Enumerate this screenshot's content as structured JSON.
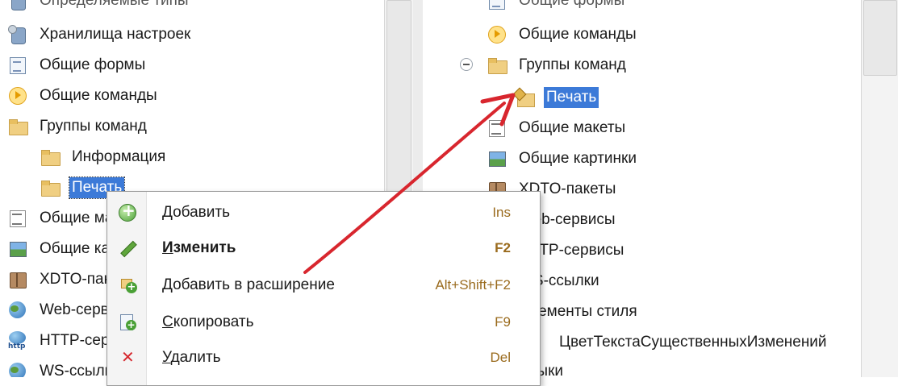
{
  "left_tree": {
    "top_partial": "Определяемые типы",
    "items": [
      "Хранилища настроек",
      "Общие формы",
      "Общие команды",
      "Группы команд",
      "Информация",
      "Печать",
      "Общие макеты",
      "Общие картинки",
      "XDTO-пакеты",
      "Web-сервисы",
      "HTTP-сервисы",
      "WS-ссылки"
    ]
  },
  "right_tree": {
    "top_partial": "Общие формы",
    "items": [
      "Общие команды",
      "Группы команд",
      "Печать",
      "Общие макеты",
      "Общие картинки",
      "XDTO-пакеты",
      "Web-сервисы",
      "HTTP-сервисы",
      "WS-ссылки",
      "Элементы стиля",
      "ЦветТекстаСущественныхИзменений",
      "Языки"
    ]
  },
  "context_menu": {
    "items": [
      {
        "label": "Добавить",
        "shortcut": "Ins",
        "icon": "add-icon"
      },
      {
        "label": "Изменить",
        "shortcut": "F2",
        "icon": "edit-icon",
        "bold": true
      },
      {
        "label": "Добавить в расширение",
        "shortcut": "Alt+Shift+F2",
        "icon": "add-to-extension-icon"
      },
      {
        "label": "Скопировать",
        "shortcut": "F9",
        "icon": "copy-icon"
      },
      {
        "label": "Удалить",
        "shortcut": "Del",
        "icon": "delete-icon"
      }
    ]
  },
  "colors": {
    "selection": "#3c7ad8",
    "arrow": "#d8262e",
    "shortcut": "#9a6b1e"
  }
}
